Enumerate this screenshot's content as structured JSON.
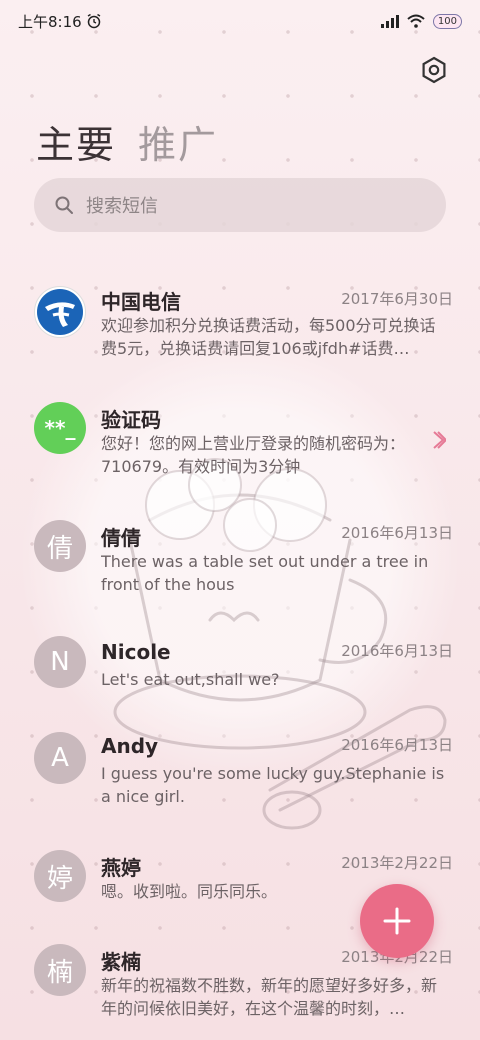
{
  "status_bar": {
    "time": "上午8:16",
    "battery": "100"
  },
  "tabs": [
    {
      "label": "主要"
    },
    {
      "label": "推广"
    }
  ],
  "search": {
    "placeholder": "搜索短信"
  },
  "messages": [
    {
      "name": "中国电信",
      "date": "2017年6月30日",
      "preview": "欢迎参加积分兑换话费活动，每500分可兑换话费5元，兑换话费请回复106或jfdh#话费…",
      "avatar": "",
      "avatar_icon": "china-telecom-logo-icon"
    },
    {
      "name": "验证码",
      "date": "",
      "preview": "您好！您的网上营业厅登录的随机密码为：710679。有效时间为3分钟",
      "avatar": "**_",
      "avatar_icon": "verification-code-icon"
    },
    {
      "name": "倩倩",
      "date": "2016年6月13日",
      "preview": "There was a table set out under a tree in front of the hous",
      "avatar": "倩"
    },
    {
      "name": "Nicole",
      "date": "2016年6月13日",
      "preview": "Let's eat out,shall we?",
      "avatar": "N"
    },
    {
      "name": "Andy",
      "date": "2016年6月13日",
      "preview": "I guess you're some lucky guy.Stephanie is a nice girl.",
      "avatar": "A"
    },
    {
      "name": "燕婷",
      "date": "2013年2月22日",
      "preview": "嗯。收到啦。同乐同乐。",
      "avatar": "婷"
    },
    {
      "name": "紫楠",
      "date": "2013年2月22日",
      "preview": "新年的祝福数不胜数，新年的愿望好多好多，新年的问候依旧美好，在这个温馨的时刻，…",
      "avatar": "楠"
    }
  ],
  "colors": {
    "accent": "#ea6c87",
    "avatar_gray": "#c9b9bd",
    "avatar_green": "#62cf58",
    "background": "#f8e6e8"
  }
}
